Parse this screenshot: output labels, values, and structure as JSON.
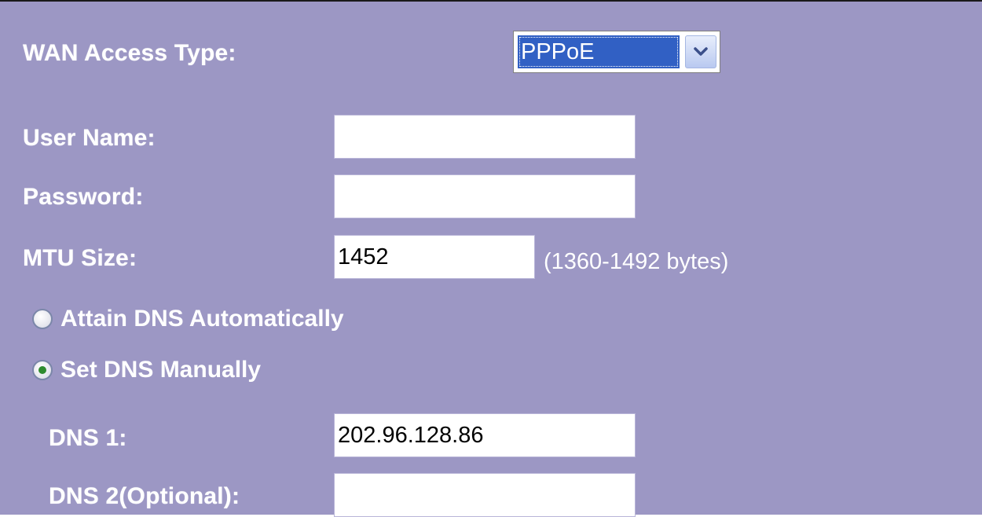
{
  "wan_access_type": {
    "label": "WAN Access Type:",
    "selected": "PPPoE"
  },
  "user_name": {
    "label": "User Name:",
    "value": ""
  },
  "password": {
    "label": "Password:",
    "value": ""
  },
  "mtu_size": {
    "label": "MTU Size:",
    "value": "1452",
    "hint": "(1360-1492 bytes)"
  },
  "dns_mode": {
    "auto_label": "Attain DNS Automatically",
    "manual_label": "Set DNS Manually",
    "selected": "manual"
  },
  "dns1": {
    "label": "DNS 1:",
    "value": "202.96.128.86"
  },
  "dns2": {
    "label": "DNS 2(Optional):",
    "value": ""
  },
  "colors": {
    "panel_background": "#9c97c4",
    "select_highlight": "#3160c4",
    "radio_checked": "#2e8b2e"
  },
  "icons": {
    "select_arrow": "chevron-down-icon"
  }
}
